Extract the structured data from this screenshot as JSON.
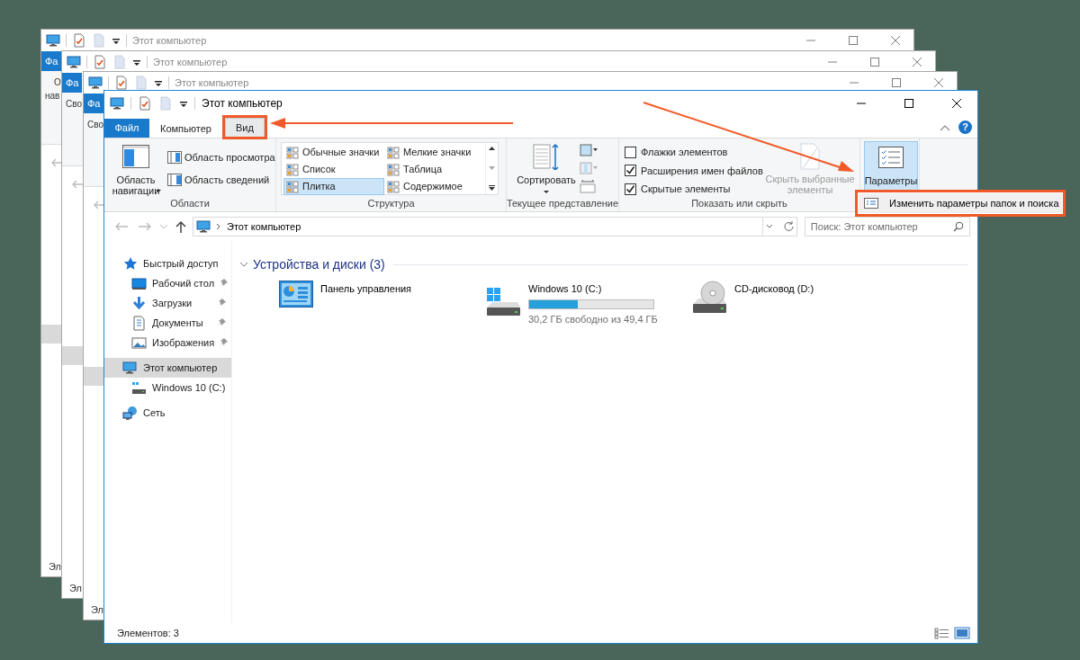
{
  "background_windows": [
    {
      "title": "Этот компьютер",
      "file_tab": "Фа",
      "ribbon_texts": [
        "О",
        "нав"
      ],
      "status": "Эл"
    },
    {
      "title": "Этот компьютер",
      "file_tab": "Фа",
      "ribbon_texts": [
        "Сво"
      ],
      "status": "Эл"
    },
    {
      "title": "Этот компьютер",
      "file_tab": "Фа",
      "ribbon_texts": [
        "Сво"
      ],
      "status": "Эл"
    }
  ],
  "window": {
    "title": "Этот компьютер",
    "help_glyph": "?"
  },
  "ribbon_tabs": [
    {
      "label": "Файл",
      "kind": "file",
      "selected": false,
      "highlighted": false
    },
    {
      "label": "Компьютер",
      "kind": "tab",
      "selected": false,
      "highlighted": false
    },
    {
      "label": "Вид",
      "kind": "tab",
      "selected": true,
      "highlighted": true
    }
  ],
  "ribbon_groups": [
    {
      "label": "Области",
      "kind": "panes",
      "nav_button": "Область навигации",
      "items": [
        "Область просмотра",
        "Область сведений"
      ]
    },
    {
      "label": "Структура",
      "kind": "layout",
      "options": [
        {
          "label": "Обычные значки",
          "selected": false
        },
        {
          "label": "Мелкие значки",
          "selected": false
        },
        {
          "label": "Список",
          "selected": false
        },
        {
          "label": "Таблица",
          "selected": false
        },
        {
          "label": "Плитка",
          "selected": true
        },
        {
          "label": "Содержимое",
          "selected": false
        }
      ]
    },
    {
      "label": "Текущее представление",
      "kind": "view",
      "sort_button": "Сортировать"
    },
    {
      "label": "Показать или скрыть",
      "kind": "show",
      "checkboxes": [
        {
          "label": "Флажки элементов",
          "checked": false
        },
        {
          "label": "Расширения имен файлов",
          "checked": true
        },
        {
          "label": "Скрытые элементы",
          "checked": true
        }
      ],
      "hide_button": {
        "label": "Скрыть выбранные элементы",
        "disabled": true
      }
    }
  ],
  "options_button": {
    "label": "Параметры",
    "pressed": true
  },
  "options_menu": [
    {
      "label": "Изменить параметры папок и поиска",
      "highlighted": true
    }
  ],
  "address_bar": {
    "path": "Этот компьютер"
  },
  "search_field": {
    "placeholder": "Поиск: Этот компьютер"
  },
  "navigation": [
    {
      "label": "Быстрый доступ",
      "kind": "star",
      "selected": false,
      "children": [
        {
          "label": "Рабочий стол",
          "kind": "desktop",
          "pinned": true,
          "selected": false
        },
        {
          "label": "Загрузки",
          "kind": "download",
          "pinned": true,
          "selected": false
        },
        {
          "label": "Документы",
          "kind": "document",
          "pinned": true,
          "selected": false
        },
        {
          "label": "Изображения",
          "kind": "pictures",
          "pinned": true,
          "selected": false
        }
      ]
    },
    {
      "label": "Этот компьютер",
      "kind": "pc",
      "selected": true,
      "children": [
        {
          "label": "Windows 10 (C:)",
          "kind": "drive",
          "pinned": false,
          "selected": false
        }
      ]
    },
    {
      "label": "Сеть",
      "kind": "network",
      "selected": false
    }
  ],
  "content": {
    "group": {
      "label": "Устройства и диски (3)",
      "expanded": true
    },
    "items": [
      {
        "name": "Панель управления",
        "kind": "control_panel"
      },
      {
        "name": "Windows 10 (C:)",
        "kind": "system_drive",
        "level": 0.39,
        "detail": "30,2 ГБ свободно из 49,4 ГБ"
      },
      {
        "name": "CD-дисковод (D:)",
        "kind": "cd_drive"
      }
    ]
  },
  "status_bar": {
    "text": "Элементов: 3"
  }
}
